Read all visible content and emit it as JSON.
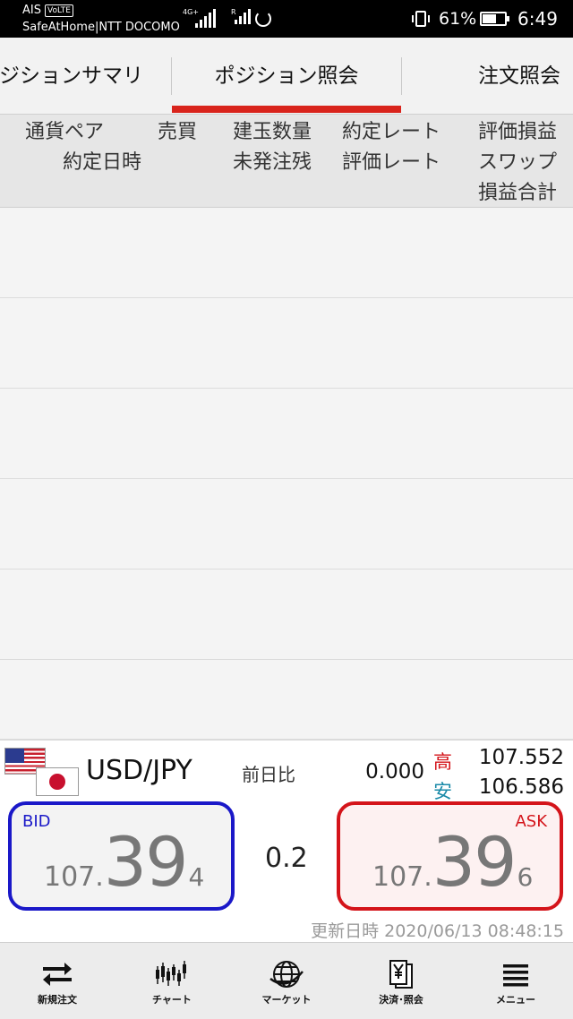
{
  "status_bar": {
    "carrier1": "AIS",
    "volte": "VoLTE",
    "carrier2": "SafeAtHome|NTT DOCOMO",
    "net1": "4G+",
    "net2": "R",
    "battery_pct": "61%",
    "battery_level": 0.61,
    "time": "6:49"
  },
  "tabs": [
    {
      "label": "ジションサマリ"
    },
    {
      "label": "ポジション照会"
    },
    {
      "label": "注文照会"
    }
  ],
  "table_header": {
    "pair": "通貨ペア",
    "side": "売買",
    "quantity": "建玉数量",
    "contract_rate": "約定レート",
    "valuation_pl": "評価損益",
    "contract_datetime": "約定日時",
    "unordered": "未発注残",
    "valuation_rate": "評価レート",
    "swap": "スワップ",
    "pl_total": "損益合計"
  },
  "ticker": {
    "pair": "USD/JPY",
    "prev_label": "前日比",
    "prev_value": "0.000",
    "high_label": "高",
    "high_value": "107.552",
    "low_label": "安",
    "low_value": "106.586",
    "bid": {
      "label": "BID",
      "pre": "107.",
      "big": "39",
      "last": "4"
    },
    "ask": {
      "label": "ASK",
      "pre": "107.",
      "big": "39",
      "last": "6"
    },
    "spread": "0.2",
    "updated": "更新日時 2020/06/13 08:48:15"
  },
  "nav": [
    {
      "label": "新規注文",
      "icon": "swap-arrows-icon"
    },
    {
      "label": "チャート",
      "icon": "candlestick-chart-icon"
    },
    {
      "label": "マーケット",
      "icon": "globe-icon"
    },
    {
      "label": "決済･照会",
      "icon": "yen-document-icon"
    },
    {
      "label": "メニュー",
      "icon": "hamburger-menu-icon"
    }
  ],
  "colors": {
    "tab_indicator": "#d9241c",
    "bid": "#1a18c8",
    "ask": "#d4141a",
    "high": "#d4141a",
    "low": "#1a8aa8"
  }
}
